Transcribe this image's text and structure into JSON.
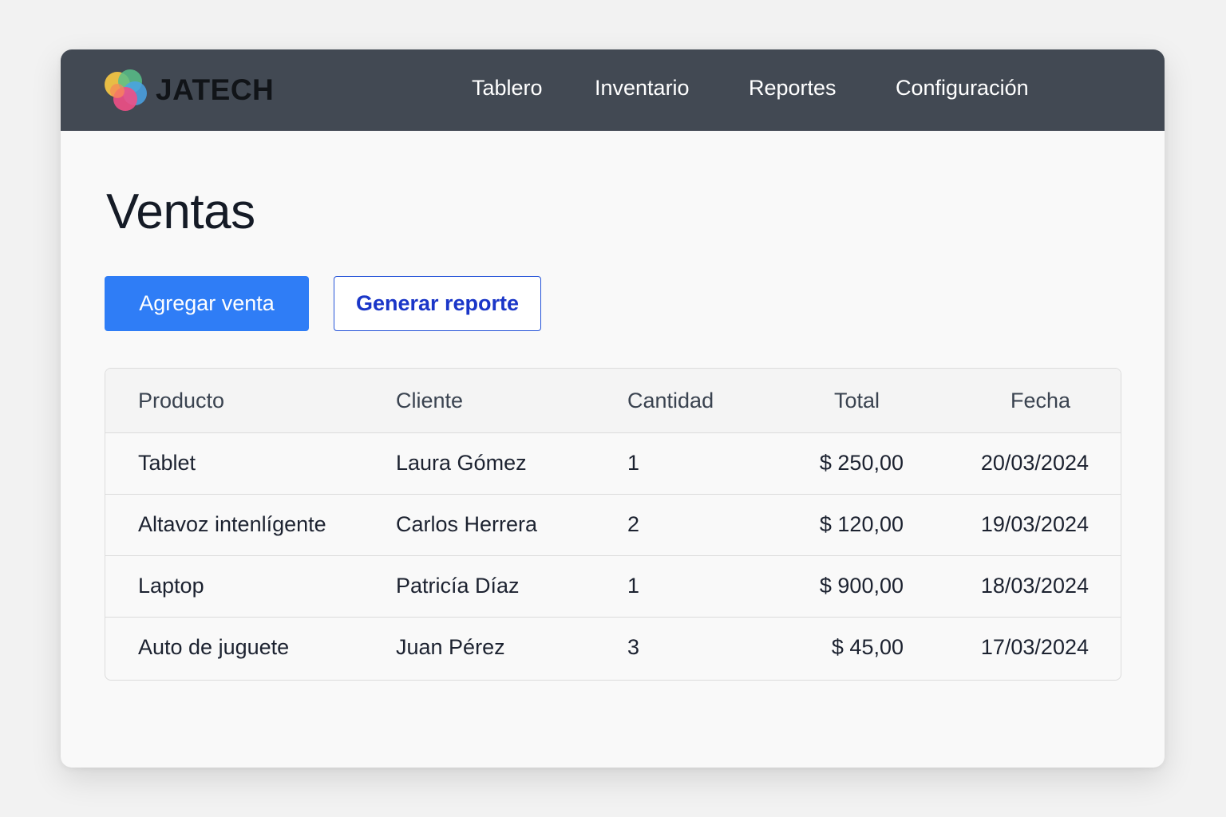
{
  "brand": {
    "name": "JATECH",
    "logo_icon": "overlapping-circles-logo",
    "logo_colors": [
      "#f6c844",
      "#58c08a",
      "#4aa3e6",
      "#f04f86",
      "#f6875a"
    ]
  },
  "nav": {
    "items": [
      {
        "label": "Tablero"
      },
      {
        "label": "Inventario"
      },
      {
        "label": "Reportes"
      },
      {
        "label": "Configuración"
      }
    ]
  },
  "page": {
    "title": "Ventas"
  },
  "actions": {
    "add_label": "Agregar venta",
    "report_label": "Generar reporte"
  },
  "table": {
    "headers": {
      "product": "Producto",
      "client": "Cliente",
      "quantity": "Cantidad",
      "total": "Total",
      "date": "Fecha"
    },
    "rows": [
      {
        "product": "Tablet",
        "client": "Laura Gómez",
        "quantity": "1",
        "total": "$ 250,00",
        "date": "20/03/2024"
      },
      {
        "product": "Altavoz intenlígente",
        "client": "Carlos Herrera",
        "quantity": "2",
        "total": "$ 120,00",
        "date": "19/03/2024"
      },
      {
        "product": "Laptop",
        "client": "Patricía Díaz",
        "quantity": "1",
        "total": "$ 900,00",
        "date": "18/03/2024"
      },
      {
        "product": "Auto de juguete",
        "client": "Juan Pérez",
        "quantity": "3",
        "total": "$ 45,00",
        "date": "17/03/2024"
      }
    ]
  },
  "colors": {
    "navbar_bg": "#424953",
    "primary": "#2f7df6",
    "outline_text": "#1a36c8"
  }
}
